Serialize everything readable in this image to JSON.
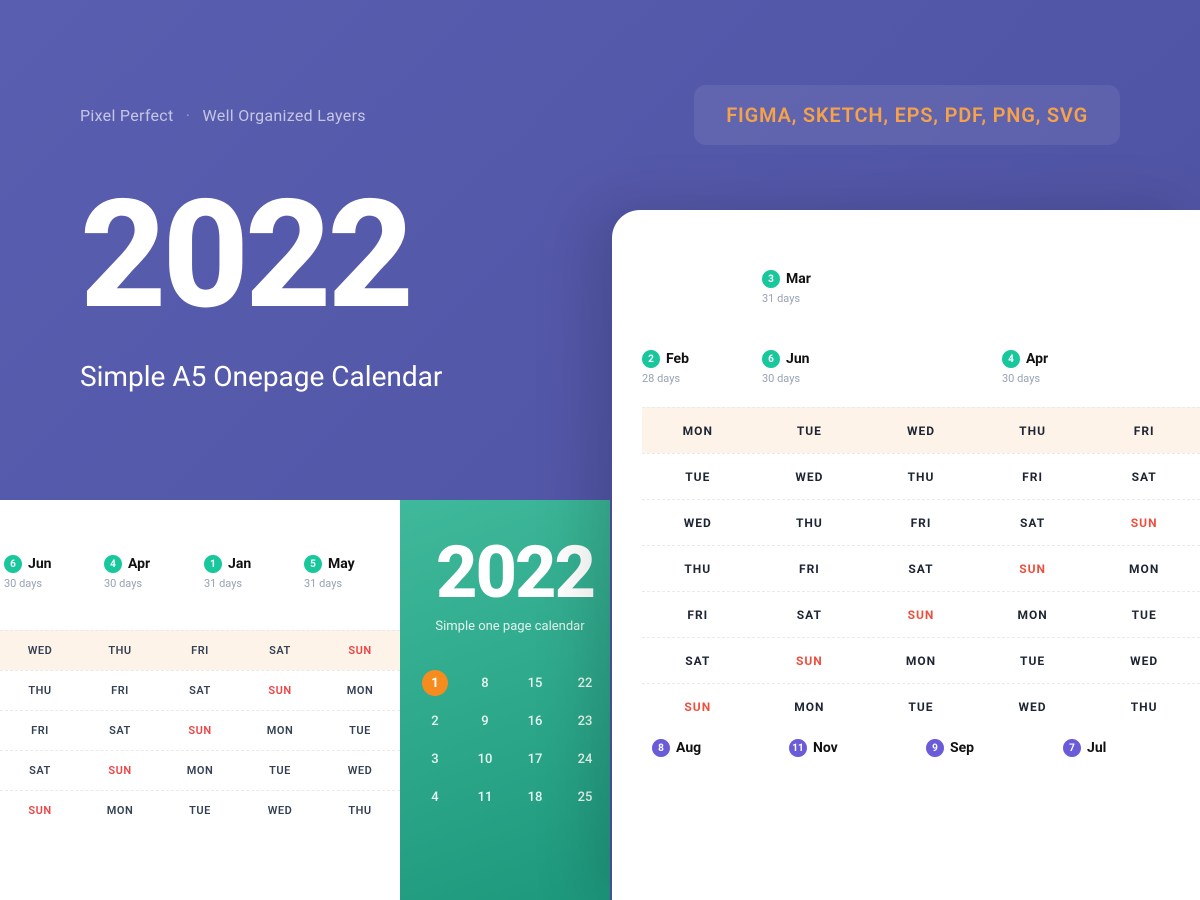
{
  "features": {
    "a": "Pixel Perfect",
    "b": "Well Organized Layers"
  },
  "formats": "FIGMA, SKETCH, EPS, PDF, PNG, SVG",
  "hero": {
    "year": "2022",
    "subtitle": "Simple A5 Onepage Calendar"
  },
  "leftPanel": {
    "months": [
      {
        "num": "6",
        "name": "Jun",
        "days": "30 days"
      },
      {
        "num": "4",
        "name": "Apr",
        "days": "30 days"
      },
      {
        "num": "1",
        "name": "Jan",
        "days": "31 days"
      },
      {
        "num": "5",
        "name": "May",
        "days": "31 days"
      }
    ],
    "rows": [
      [
        "WED",
        "THU",
        "FRI",
        "SAT",
        "SUN"
      ],
      [
        "THU",
        "FRI",
        "SAT",
        "SUN",
        "MON"
      ],
      [
        "FRI",
        "SAT",
        "SUN",
        "MON",
        "TUE"
      ],
      [
        "SAT",
        "SUN",
        "MON",
        "TUE",
        "WED"
      ],
      [
        "SUN",
        "MON",
        "TUE",
        "WED",
        "THU"
      ]
    ]
  },
  "greenPanel": {
    "year": "2022",
    "subtitle": "Simple one page calendar",
    "rows": [
      [
        "1",
        "8",
        "15",
        "22"
      ],
      [
        "2",
        "9",
        "16",
        "23"
      ],
      [
        "3",
        "10",
        "17",
        "24"
      ],
      [
        "4",
        "11",
        "18",
        "25"
      ]
    ]
  },
  "card": {
    "top": {
      "num": "3",
      "name": "Mar",
      "days": "31 days"
    },
    "row2": [
      {
        "num": "2",
        "name": "Feb",
        "days": "28 days"
      },
      {
        "num": "6",
        "name": "Jun",
        "days": "30 days"
      },
      {
        "num": "",
        "name": "",
        "days": ""
      },
      {
        "num": "4",
        "name": "Apr",
        "days": "30 days"
      }
    ],
    "grid": [
      [
        "MON",
        "TUE",
        "WED",
        "THU",
        "FRI"
      ],
      [
        "TUE",
        "WED",
        "THU",
        "FRI",
        "SAT"
      ],
      [
        "WED",
        "THU",
        "FRI",
        "SAT",
        "SUN"
      ],
      [
        "THU",
        "FRI",
        "SAT",
        "SUN",
        "MON"
      ],
      [
        "FRI",
        "SAT",
        "SUN",
        "MON",
        "TUE"
      ],
      [
        "SAT",
        "SUN",
        "MON",
        "TUE",
        "WED"
      ],
      [
        "SUN",
        "MON",
        "TUE",
        "WED",
        "THU"
      ]
    ],
    "bottom": [
      {
        "num": "8",
        "name": "Aug"
      },
      {
        "num": "11",
        "name": "Nov"
      },
      {
        "num": "9",
        "name": "Sep"
      },
      {
        "num": "7",
        "name": "Jul"
      }
    ]
  }
}
